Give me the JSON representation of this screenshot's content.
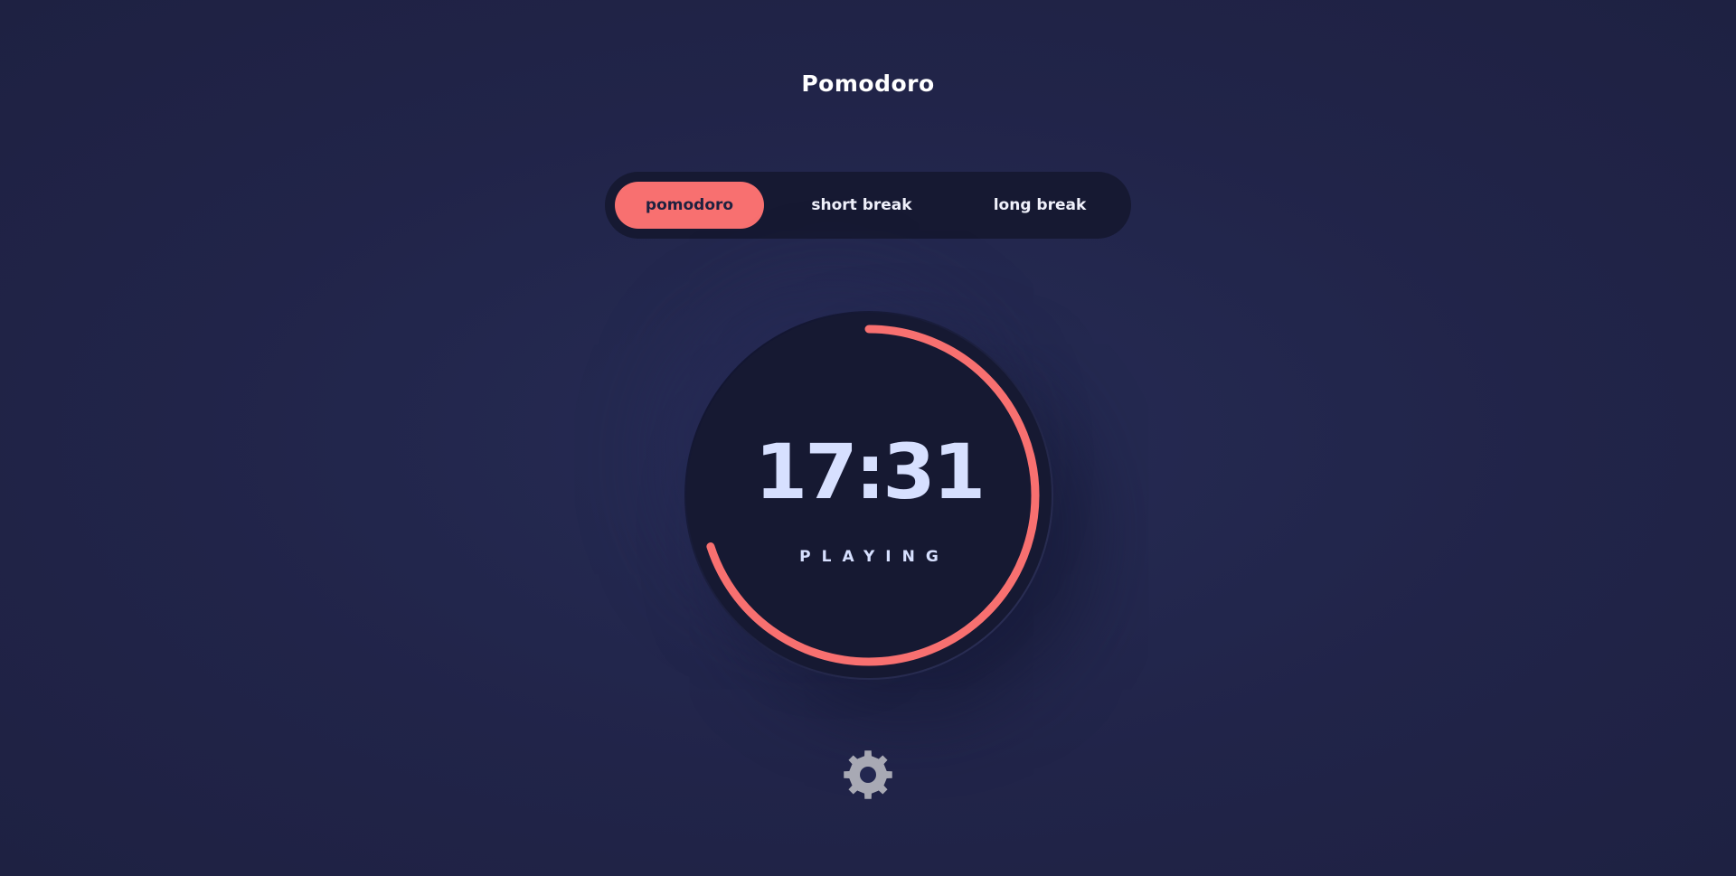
{
  "header": {
    "title": "Pomodoro"
  },
  "modes": [
    {
      "label": "pomodoro",
      "active": true
    },
    {
      "label": "short break",
      "active": false
    },
    {
      "label": "long break",
      "active": false
    }
  ],
  "timer": {
    "time": "17:31",
    "status": "PLAYING",
    "progress_remaining": 0.7
  },
  "settings": {
    "icon": "gear-icon"
  },
  "colors": {
    "accent": "#f87070",
    "panel": "#161932",
    "background": "#1e213f",
    "text_light": "#d7e0ff",
    "gear": "#a8a9b4"
  }
}
